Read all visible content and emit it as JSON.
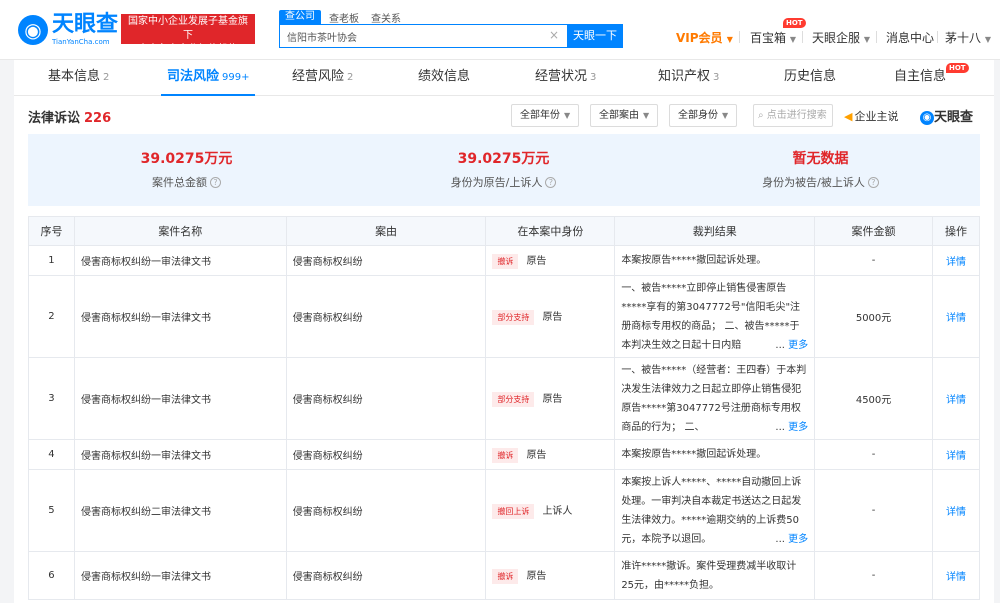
{
  "header": {
    "logo_text": "天眼查",
    "logo_sub": "TianYanCha.com",
    "gov_line1": "国家中小企业发展子基金旗下",
    "gov_line2": "官方备案企业征信机构",
    "search_tabs": [
      "查公司",
      "查老板",
      "查关系"
    ],
    "search_value": "信阳市茶叶协会",
    "search_button": "天眼一下",
    "nav": {
      "vip": "VIP会员",
      "baibao": "百宝箱",
      "qifu": "天眼企服",
      "messages": "消息中心",
      "user": "茅十八"
    },
    "hot": "HOT"
  },
  "tabs": [
    {
      "label": "基本信息",
      "count": "2"
    },
    {
      "label": "司法风险",
      "count": "999+"
    },
    {
      "label": "经营风险",
      "count": "2"
    },
    {
      "label": "绩效信息",
      "count": ""
    },
    {
      "label": "经营状况",
      "count": "3"
    },
    {
      "label": "知识产权",
      "count": "3"
    },
    {
      "label": "历史信息",
      "count": ""
    },
    {
      "label": "自主信息",
      "count": ""
    }
  ],
  "section": {
    "title": "法律诉讼",
    "count": "226"
  },
  "filters": {
    "year": "全部年份",
    "cause": "全部案由",
    "role": "全部身份",
    "search_placeholder": "点击进行搜索",
    "speak": "企业主说",
    "brand": "天眼查"
  },
  "stats": [
    {
      "value": "39.0275万元",
      "label": "案件总金额"
    },
    {
      "value": "39.0275万元",
      "label": "身份为原告/上诉人"
    },
    {
      "value": "暂无数据",
      "label": "身份为被告/被上诉人"
    }
  ],
  "table": {
    "headers": [
      "序号",
      "案件名称",
      "案由",
      "在本案中身份",
      "裁判结果",
      "案件金额",
      "操作"
    ],
    "rows": [
      {
        "no": "1",
        "name": "侵害商标权纠纷一审法律文书",
        "cause": "侵害商标权纠纷",
        "tag": "撤诉",
        "tag_color": "red",
        "role": "原告",
        "result": "本案按原告*****撤回起诉处理。",
        "amount": "-",
        "more": "",
        "op": "详情"
      },
      {
        "no": "2",
        "name": "侵害商标权纠纷一审法律文书",
        "cause": "侵害商标权纠纷",
        "tag": "部分支持",
        "tag_color": "red",
        "role": "原告",
        "result": "一、被告*****立即停止销售侵害原告*****享有的第3047772号\"信阳毛尖\"注册商标专用权的商品； 二、被告*****于本判决生效之日起十日内赔",
        "amount": "5000元",
        "more": "更多",
        "op": "详情"
      },
      {
        "no": "3",
        "name": "侵害商标权纠纷一审法律文书",
        "cause": "侵害商标权纠纷",
        "tag": "部分支持",
        "tag_color": "red",
        "role": "原告",
        "result": "一、被告*****（经营者：王四春）于本判决发生法律效力之日起立即停止销售侵犯原告*****第3047772号注册商标专用权商品的行为； 二、",
        "amount": "4500元",
        "more": "更多",
        "op": "详情"
      },
      {
        "no": "4",
        "name": "侵害商标权纠纷一审法律文书",
        "cause": "侵害商标权纠纷",
        "tag": "撤诉",
        "tag_color": "red",
        "role": "原告",
        "result": "本案按原告*****撤回起诉处理。",
        "amount": "-",
        "more": "",
        "op": "详情"
      },
      {
        "no": "5",
        "name": "侵害商标权纠纷二审法律文书",
        "cause": "侵害商标权纠纷",
        "tag": "撤回上诉",
        "tag_color": "red",
        "role": "上诉人",
        "result": "本案按上诉人*****、*****自动撤回上诉处理。一审判决自本裁定书送达之日起发生法律效力。*****逾期交纳的上诉费50元，本院予以退回。",
        "amount": "-",
        "more": "更多",
        "op": "详情"
      },
      {
        "no": "6",
        "name": "侵害商标权纠纷一审法律文书",
        "cause": "侵害商标权纠纷",
        "tag": "撤诉",
        "tag_color": "red",
        "role": "原告",
        "result": "准许*****撤诉。案件受理费减半收取计25元，由*****负担。",
        "amount": "-",
        "more": "",
        "op": "详情"
      }
    ]
  }
}
